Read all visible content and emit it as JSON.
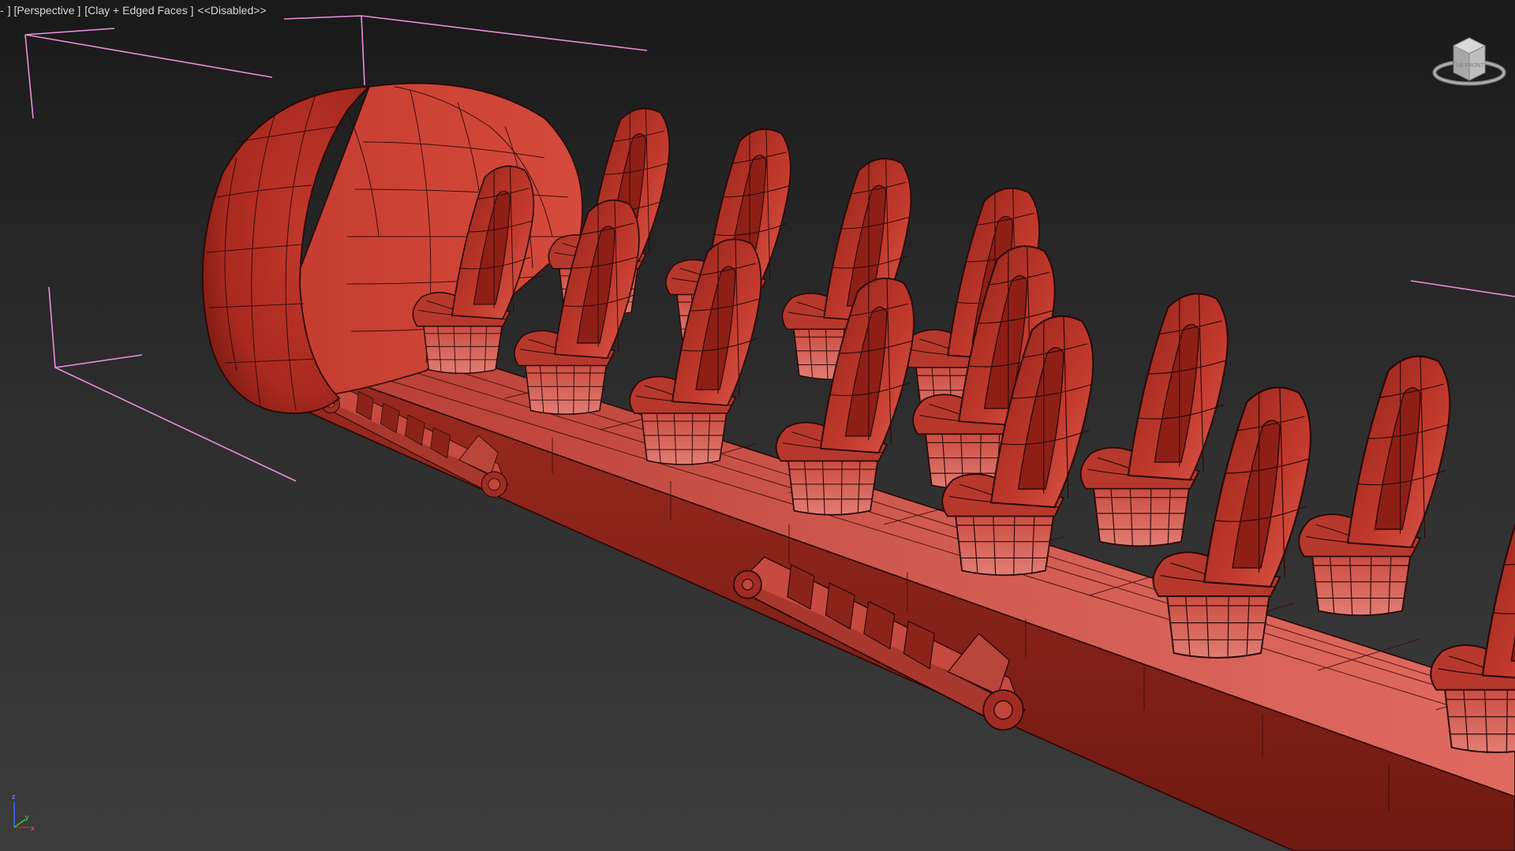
{
  "viewport": {
    "label_parts": [
      "-",
      "] [Perspective ]",
      "[Clay + Edged Faces ]",
      "<<Disabled>>"
    ]
  },
  "viewcube": {
    "icon": "viewcube-navigation-icon",
    "face_text": "LE FRONT"
  },
  "axis_gizmo": {
    "icon": "axis-tripod-icon",
    "axes": [
      "z",
      "x",
      "y"
    ]
  },
  "scene": {
    "render_mode": "Clay + Edged Faces",
    "model_description": "roller-coaster-car",
    "colors": {
      "clay": "#c2382c",
      "clay_dark": "#6b1510",
      "clay_light": "#e2605a",
      "edge": "#2b0805",
      "selection_bracket": "#e58fd8",
      "viewport_bg_top": "#191919",
      "viewport_bg_bottom": "#3c3c3c"
    }
  }
}
